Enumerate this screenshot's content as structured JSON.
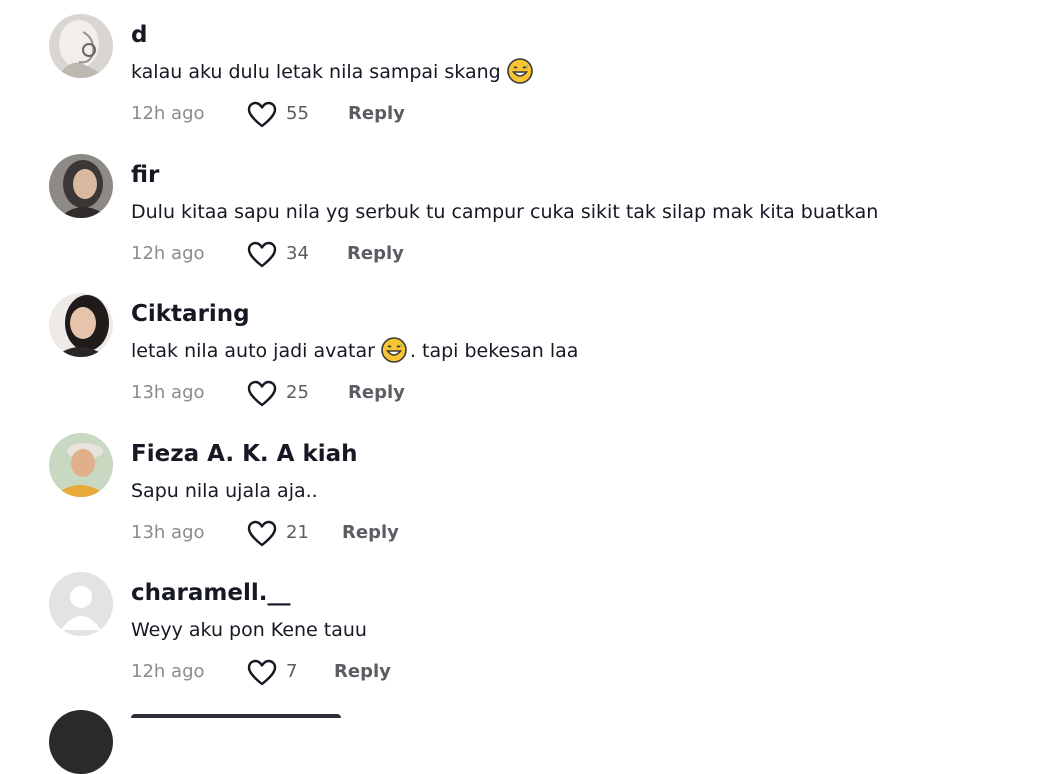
{
  "comments": [
    {
      "username": "d",
      "text_before": "kalau aku dulu letak nila sampai skang",
      "emoji": "grinning-sweat-emoji",
      "text_after": "",
      "time": "12h ago",
      "likes": "55",
      "reply_label": "Reply"
    },
    {
      "username": "fir",
      "text_before": "Dulu kitaa sapu nila yg serbuk tu campur cuka sikit tak silap mak kita buatkan",
      "emoji": "",
      "text_after": "",
      "time": "12h ago",
      "likes": "34",
      "reply_label": "Reply"
    },
    {
      "username": "Ciktaring",
      "text_before": "letak nila auto jadi avatar",
      "emoji": "grinning-sweat-emoji",
      "text_after": ". tapi bekesan laa",
      "time": "13h ago",
      "likes": "25",
      "reply_label": "Reply"
    },
    {
      "username": "Fieza A. K. A kiah",
      "text_before": "Sapu nila ujala aja..",
      "emoji": "",
      "text_after": "",
      "time": "13h ago",
      "likes": "21",
      "reply_label": "Reply"
    },
    {
      "username": "charamell.__",
      "text_before": "Weyy aku pon Kene tauu",
      "emoji": "",
      "text_after": "",
      "time": "12h ago",
      "likes": "7",
      "reply_label": "Reply"
    }
  ],
  "icons": {
    "like": "heart-outline-icon"
  },
  "colors": {
    "text": "#161823",
    "secondary": "#8a8b91",
    "action": "#5c5d63"
  }
}
